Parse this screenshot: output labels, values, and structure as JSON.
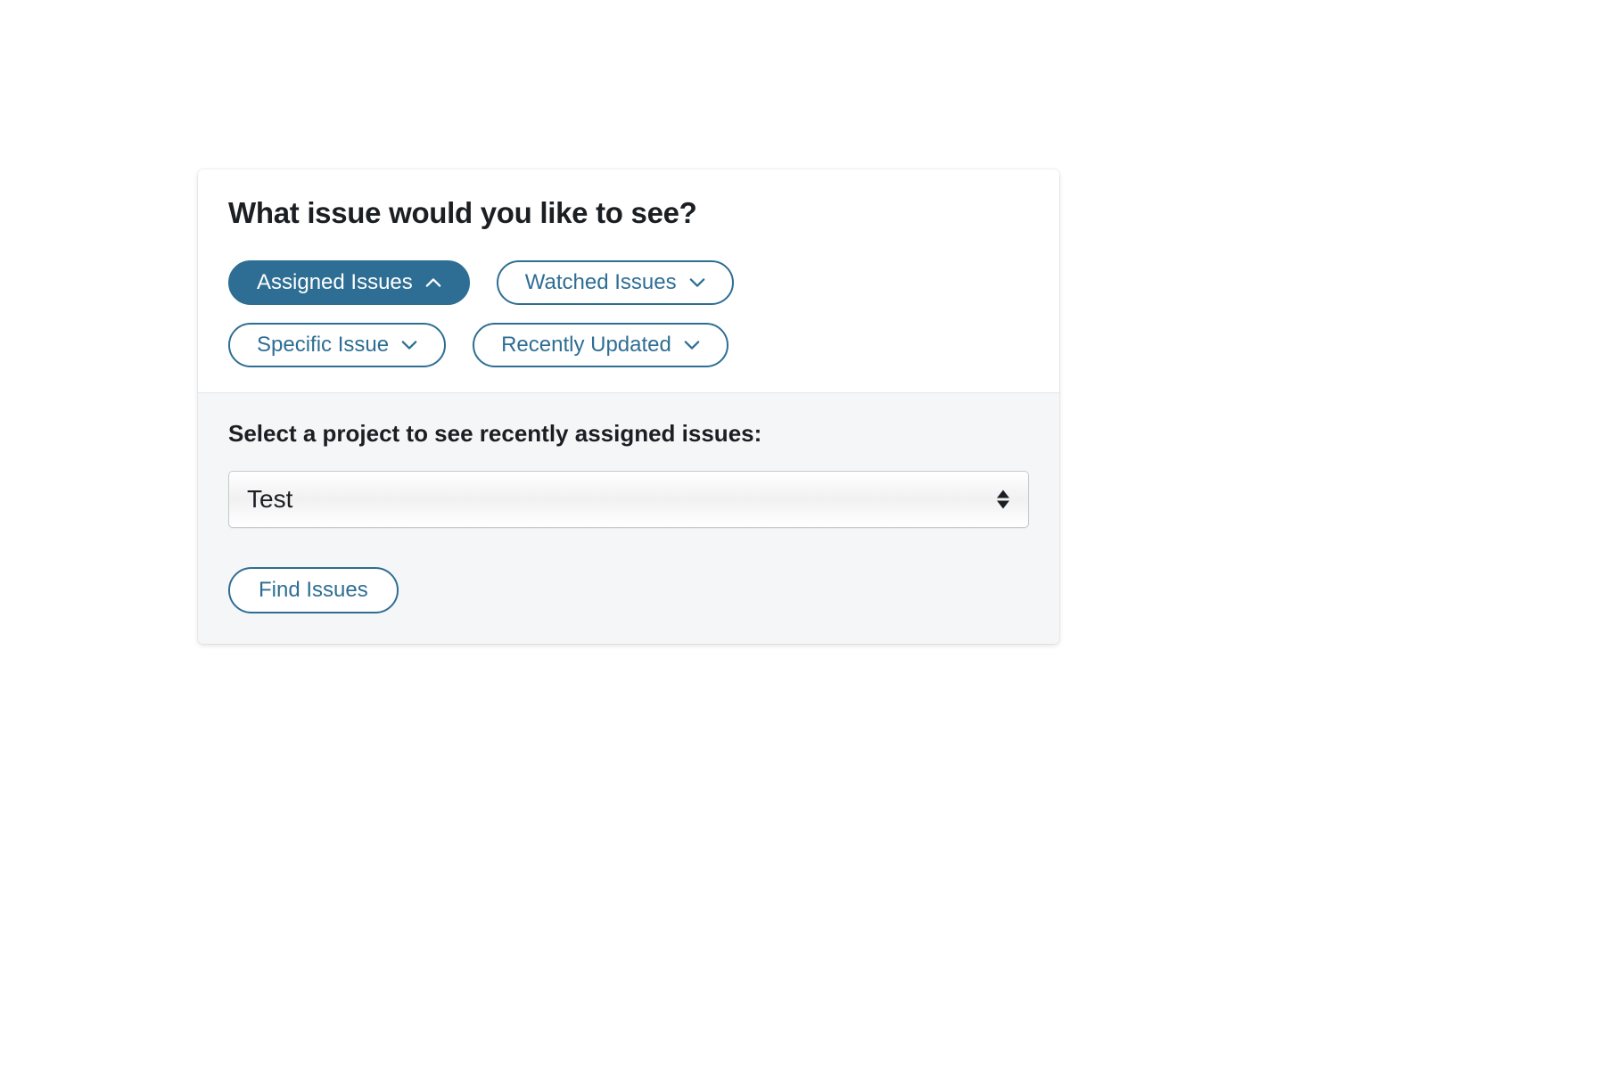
{
  "colors": {
    "accent": "#2e6e94"
  },
  "heading": "What issue would you like to see?",
  "pills": [
    {
      "label": "Assigned Issues",
      "expanded": true
    },
    {
      "label": "Watched Issues",
      "expanded": false
    },
    {
      "label": "Specific Issue",
      "expanded": false
    },
    {
      "label": "Recently Updated",
      "expanded": false
    }
  ],
  "projectSection": {
    "label": "Select a project to see recently assigned issues:",
    "selected": "Test"
  },
  "findButton": {
    "label": "Find Issues"
  }
}
